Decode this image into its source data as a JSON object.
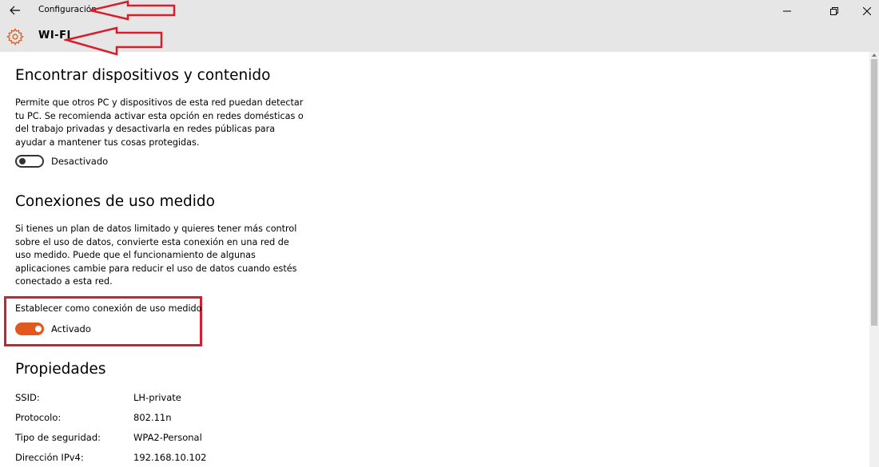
{
  "titlebar": {
    "back_icon": "back-arrow-icon",
    "app_title": "Configuración",
    "minimize_icon": "minimize-icon",
    "maximize_icon": "restore-icon",
    "close_icon": "close-icon"
  },
  "header": {
    "icon": "gear-icon",
    "title": "WI-FI"
  },
  "discover": {
    "title": "Encontrar dispositivos y contenido",
    "description": "Permite que otros PC y dispositivos de esta red puedan detectar tu PC. Se recomienda activar esta opción en redes domésticas o del trabajo privadas y desactivarla en redes públicas para ayudar a mantener tus cosas protegidas.",
    "toggle_state": "off",
    "toggle_label": "Desactivado"
  },
  "metered": {
    "title": "Conexiones de uso medido",
    "description": "Si tienes un plan de datos limitado y quieres tener más control sobre el uso de datos, convierte esta conexión en una red de uso medido. Puede que el funcionamiento de algunas aplicaciones cambie para reducir el uso de datos cuando estés conectado a esta red.",
    "setting_label": "Establecer como conexión de uso medido",
    "toggle_state": "on",
    "toggle_label": "Activado"
  },
  "properties": {
    "title": "Propiedades",
    "rows": [
      {
        "key": "SSID:",
        "value": "LH-private"
      },
      {
        "key": "Protocolo:",
        "value": "802.11n"
      },
      {
        "key": "Tipo de seguridad:",
        "value": "WPA2-Personal"
      },
      {
        "key": "Dirección IPv4:",
        "value": "192.168.10.102"
      }
    ]
  },
  "colors": {
    "chrome": "#e6e6e6",
    "accent": "#e05a1f",
    "annotation": "#d81e2a"
  }
}
